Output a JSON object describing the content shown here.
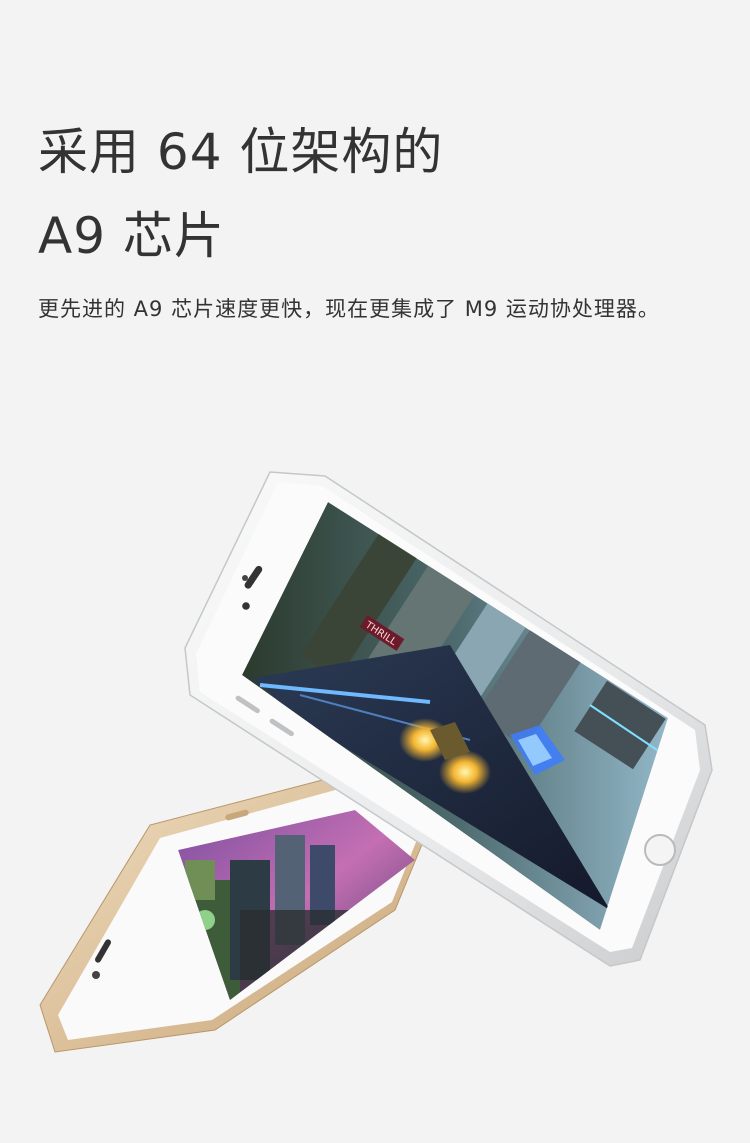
{
  "headline": {
    "line1": "采用 64 位架构的",
    "line2": "A9 芯片"
  },
  "description": "更先进的 A9 芯片速度更快，现在更集成了 M9 运动协处理器。",
  "hero": {
    "front_phone_finish": "silver",
    "back_phone_finish": "gold",
    "screen_sign_text": "THRILL"
  },
  "colors": {
    "background": "#f3f3f3",
    "text": "#333333",
    "silver_body": "#e8e9ea",
    "gold_body": "#e2c9a6"
  }
}
